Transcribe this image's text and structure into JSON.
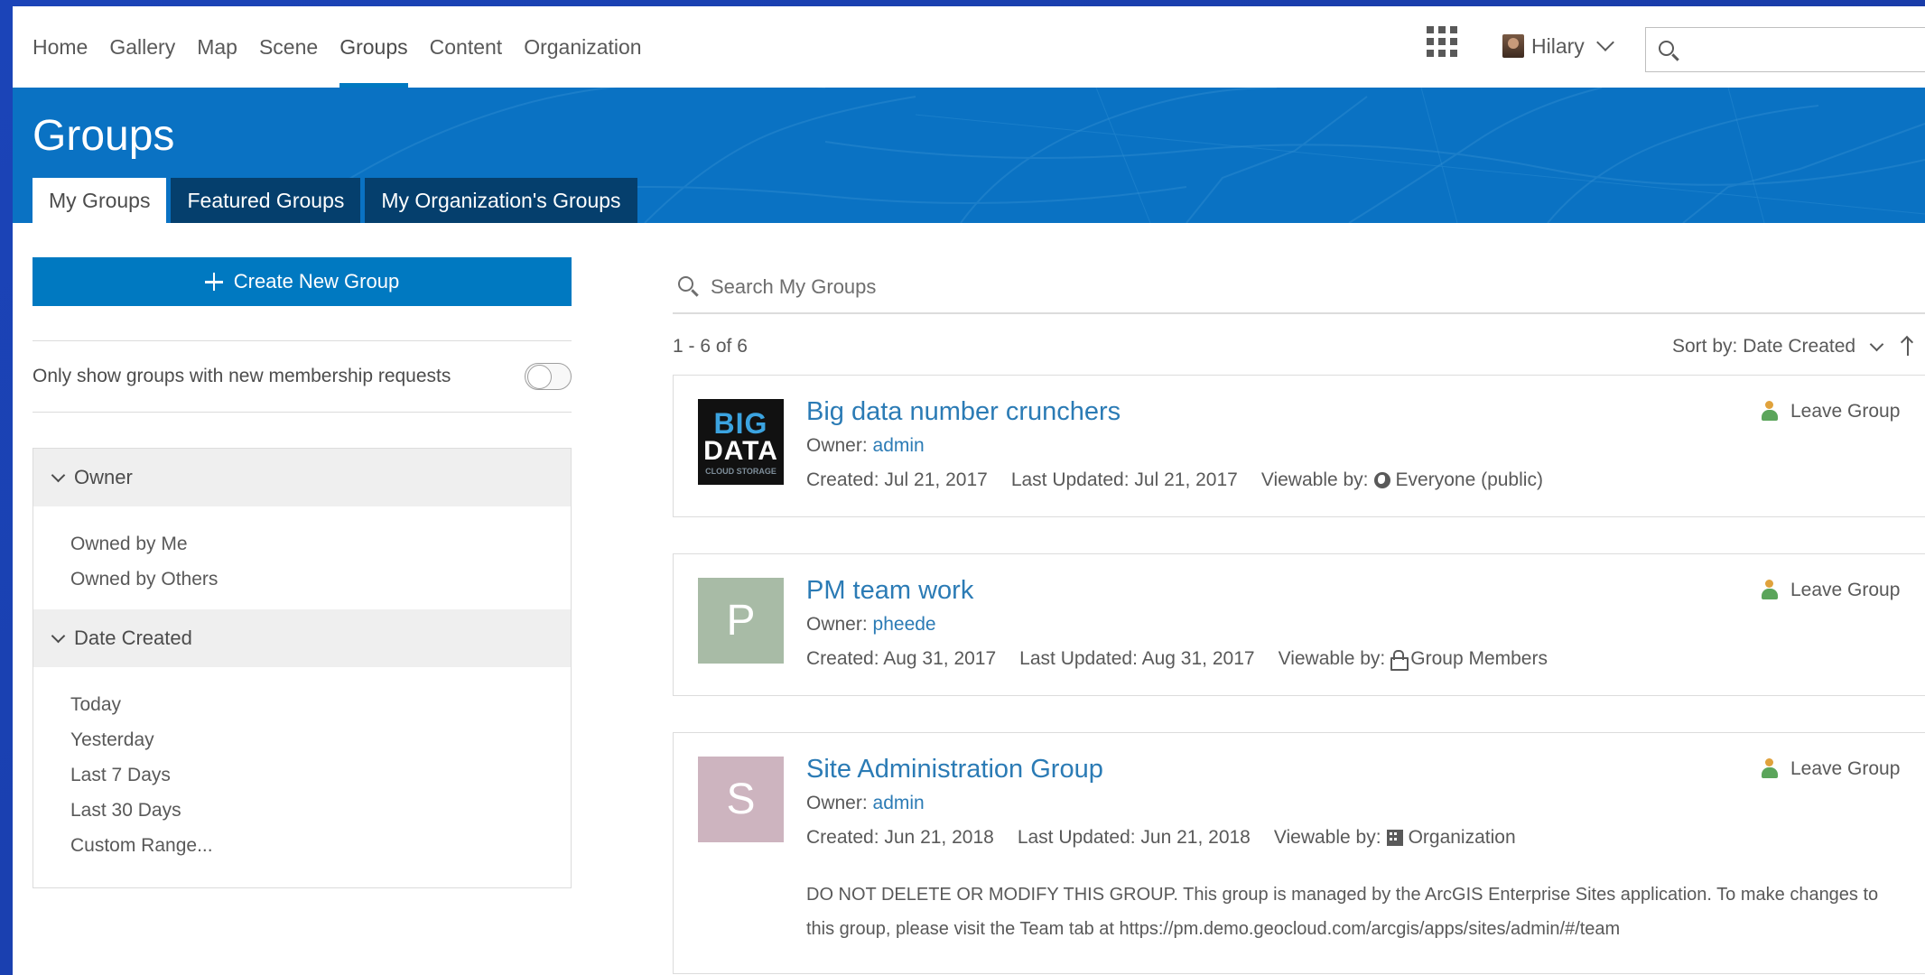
{
  "nav": {
    "links": [
      "Home",
      "Gallery",
      "Map",
      "Scene",
      "Groups",
      "Content",
      "Organization"
    ],
    "active_index": 4,
    "user_name": "Hilary"
  },
  "banner": {
    "title": "Groups",
    "tabs": [
      "My Groups",
      "Featured Groups",
      "My Organization's Groups"
    ],
    "active_tab": 0
  },
  "sidebar": {
    "create_button": "Create New Group",
    "toggle_label": "Only show groups with new membership requests",
    "toggle_on": false,
    "filters": [
      {
        "title": "Owner",
        "items": [
          "Owned by Me",
          "Owned by Others"
        ]
      },
      {
        "title": "Date Created",
        "items": [
          "Today",
          "Yesterday",
          "Last 7 Days",
          "Last 30 Days",
          "Custom Range..."
        ]
      }
    ]
  },
  "results": {
    "search_placeholder": "Search My Groups",
    "count_text": "1 - 6 of 6",
    "sort_label": "Sort by: Date Created",
    "groups": [
      {
        "title": "Big data number crunchers",
        "owner_label": "Owner: ",
        "owner": "admin",
        "created": "Created: Jul 21, 2017",
        "updated": "Last Updated: Jul 21, 2017",
        "viewable_label": "Viewable by:",
        "viewable": "Everyone (public)",
        "leave": "Leave Group",
        "thumb_line1": "BIG",
        "thumb_line2": "DATA",
        "thumb_line3": "CLOUD STORAGE"
      },
      {
        "title": "PM team work",
        "owner_label": "Owner: ",
        "owner": "pheede",
        "created": "Created: Aug 31, 2017",
        "updated": "Last Updated: Aug 31, 2017",
        "viewable_label": "Viewable by:",
        "viewable": "Group Members",
        "leave": "Leave Group",
        "thumb_letter": "P",
        "thumb_color": "#a8bba6"
      },
      {
        "title": "Site Administration Group",
        "owner_label": "Owner: ",
        "owner": "admin",
        "created": "Created: Jun 21, 2018",
        "updated": "Last Updated: Jun 21, 2018",
        "viewable_label": "Viewable by:",
        "viewable": "Organization",
        "leave": "Leave Group",
        "thumb_letter": "S",
        "thumb_color": "#cdb4bf",
        "description": "DO NOT DELETE OR MODIFY THIS GROUP. This group is managed by the ArcGIS Enterprise Sites application. To make changes to this group, please visit the Team tab at https://pm.demo.geocloud.com/arcgis/apps/sites/admin/#/team"
      }
    ]
  },
  "colors": {
    "brand_blue": "#0079c1",
    "link_blue": "#2b7bb5",
    "tab_dark": "#053f6d"
  }
}
